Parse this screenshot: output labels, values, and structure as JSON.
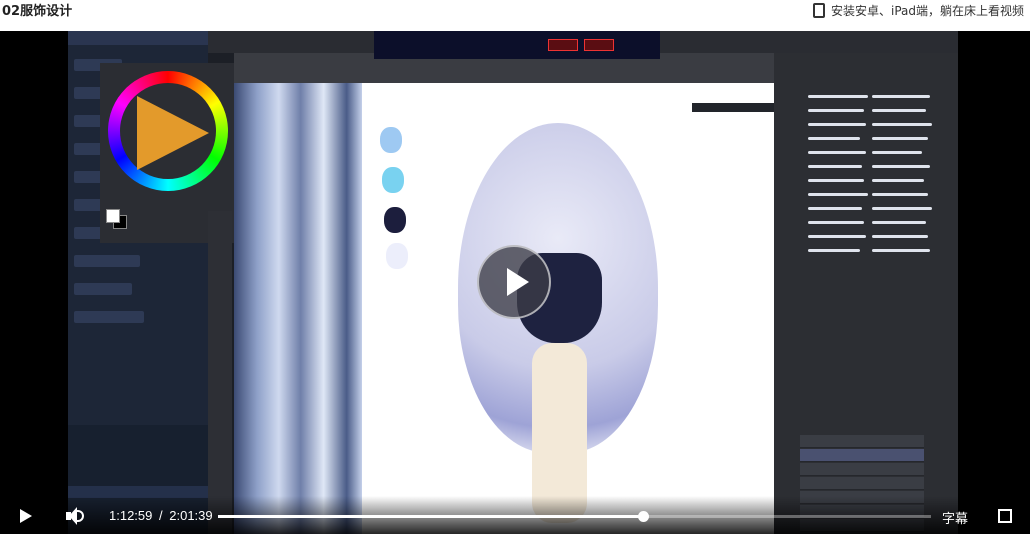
{
  "page": {
    "title": "02服饰设计",
    "promo_text": "安装安卓、iPad端，躺在床上看视频"
  },
  "player": {
    "current_time": "1:12:59",
    "separator": "/",
    "duration": "2:01:39",
    "progress_fraction": 0.596,
    "subtitle_label": "字幕",
    "icons": [
      "play-icon",
      "volume-icon",
      "fullscreen-icon",
      "big-play-icon",
      "device-icon"
    ]
  },
  "colors": {
    "swatch_1": "#9ec9f2",
    "swatch_2": "#79d2f0",
    "swatch_3": "#1c1e3d",
    "swatch_4": "#eceefb"
  }
}
